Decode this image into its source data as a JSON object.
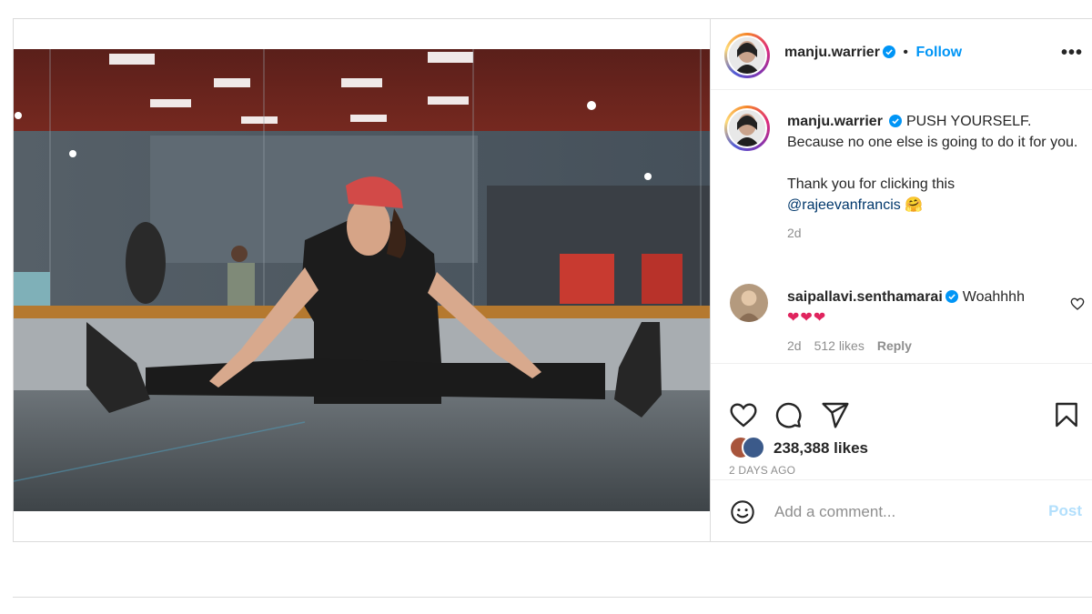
{
  "post": {
    "author": {
      "username": "manju.warrier",
      "verified": true
    },
    "header": {
      "separator": "•",
      "follow_label": "Follow",
      "more_label": "•••"
    },
    "caption": {
      "line1": "PUSH YOURSELF.",
      "line2": "Because no one else is going to do it for you.",
      "line3": "Thank you for clicking this",
      "mention": "@rajeevanfrancis",
      "emoji": "🤗",
      "time": "2d"
    },
    "comments": [
      {
        "username": "saipallavi.senthamarai",
        "verified": true,
        "text": "Woahhhh",
        "emoji": "❤❤❤",
        "time": "2d",
        "likes": "512 likes",
        "reply_label": "Reply"
      }
    ],
    "actions": {
      "like_icon": "heart-icon",
      "comment_icon": "comment-icon",
      "share_icon": "share-icon",
      "save_icon": "bookmark-icon"
    },
    "likes_count": "238,388 likes",
    "date": "2 DAYS AGO",
    "add_comment": {
      "placeholder": "Add a comment...",
      "post_label": "Post"
    },
    "colors": {
      "accent": "#0095f6",
      "muted": "#8e8e8e",
      "mention": "#00376b",
      "post_disabled": "#b2dffc"
    }
  }
}
